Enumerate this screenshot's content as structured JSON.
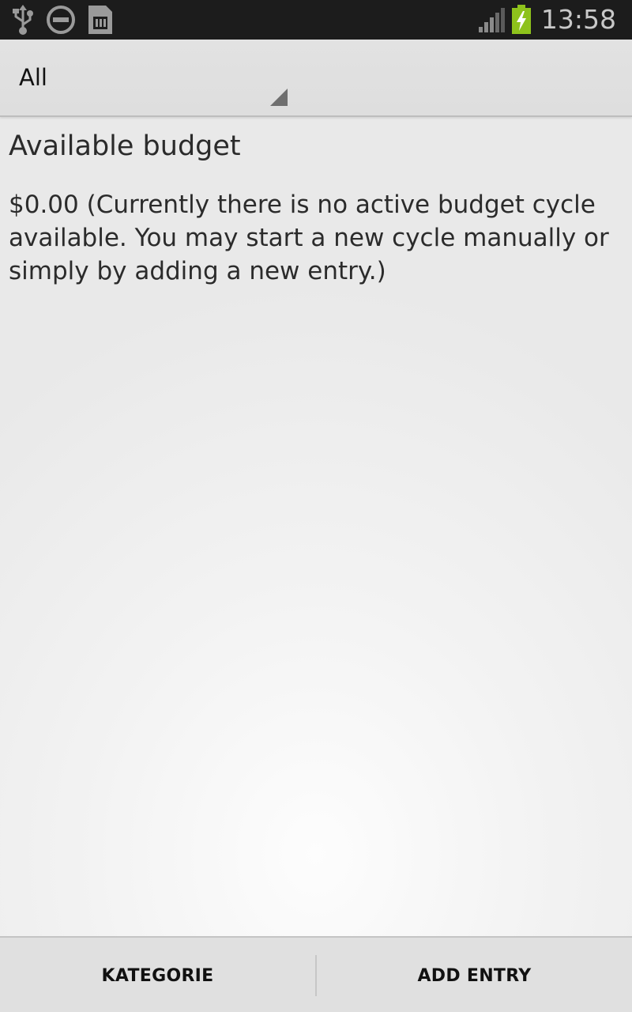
{
  "status_bar": {
    "time": "13:58",
    "icons": [
      "usb-icon",
      "do-not-disturb-icon",
      "sim-card-icon",
      "signal-icon",
      "battery-charging-icon"
    ],
    "battery_color": "#8ec21c"
  },
  "spinner": {
    "selected": "All"
  },
  "main": {
    "heading": "Available budget",
    "message": "$0.00 (Currently there is no active budget cycle available. You may start a new cycle manually or simply by adding a new entry.)"
  },
  "bottom_bar": {
    "left_label": "KATEGORIE",
    "right_label": "ADD ENTRY"
  }
}
